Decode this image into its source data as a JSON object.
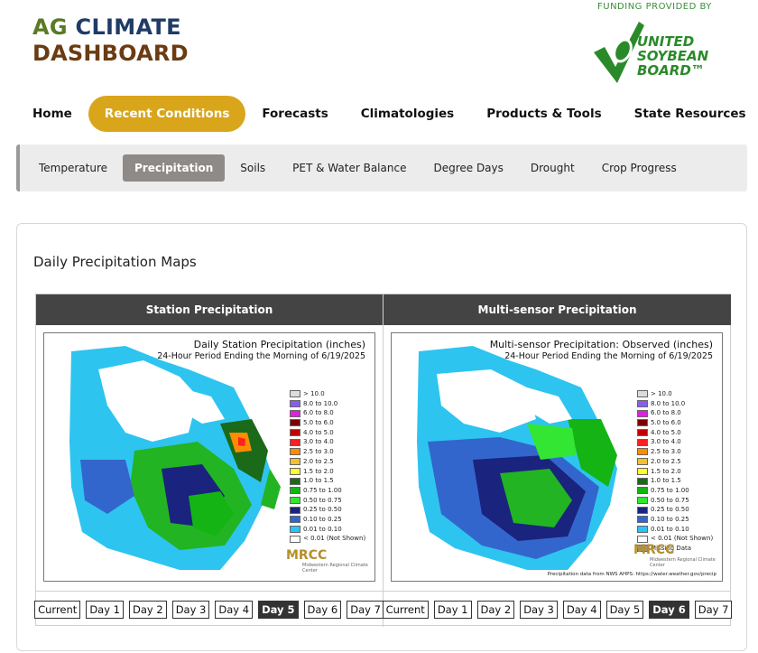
{
  "header": {
    "title_line1_a": "AG",
    "title_line1_b": "CLIMATE",
    "title_line2": "DASHBOARD",
    "funding": "FUNDING PROVIDED BY",
    "sponsor": [
      "UNITED",
      "SOYBEAN",
      "BOARD™"
    ]
  },
  "mainnav": [
    "Home",
    "Recent Conditions",
    "Forecasts",
    "Climatologies",
    "Products & Tools",
    "State Resources"
  ],
  "subnav": [
    "Temperature",
    "Precipitation",
    "Soils",
    "PET & Water Balance",
    "Degree Days",
    "Drought",
    "Crop Progress"
  ],
  "panel_title": "Daily Precipitation Maps",
  "station": {
    "header": "Station Precipitation",
    "map_title": "Daily Station Precipitation (inches)",
    "map_sub": "24-Hour Period Ending the Morning of 6/19/2025",
    "days": [
      "Current",
      "Day 1",
      "Day 2",
      "Day 3",
      "Day 4",
      "Day 5",
      "Day 6",
      "Day 7"
    ],
    "active_day": "Day 5"
  },
  "multisensor": {
    "header": "Multi-sensor Precipitation",
    "map_title": "Multi-sensor Precipitation: Observed (inches)",
    "map_sub": "24-Hour Period Ending the Morning of 6/19/2025",
    "credit": "Precipitation data from NWS AHPS: https://water.weather.gov/precip",
    "days": [
      "Current",
      "Day 1",
      "Day 2",
      "Day 3",
      "Day 4",
      "Day 5",
      "Day 6",
      "Day 7"
    ],
    "active_day": "Day 6"
  },
  "legend_station": [
    {
      "label": "> 10.0",
      "color": "#dcdcdc"
    },
    {
      "label": "8.0 to 10.0",
      "color": "#8a5cf0"
    },
    {
      "label": "6.0 to 8.0",
      "color": "#e020e0"
    },
    {
      "label": "5.0 to 6.0",
      "color": "#7a0000"
    },
    {
      "label": "4.0 to 5.0",
      "color": "#c00000"
    },
    {
      "label": "3.0 to 4.0",
      "color": "#ff2020"
    },
    {
      "label": "2.5 to 3.0",
      "color": "#ff8c00"
    },
    {
      "label": "2.0 to 2.5",
      "color": "#f2c030"
    },
    {
      "label": "1.5 to 2.0",
      "color": "#ffff33"
    },
    {
      "label": "1.0 to 1.5",
      "color": "#1a6a1a"
    },
    {
      "label": "0.75 to 1.00",
      "color": "#14b414"
    },
    {
      "label": "0.50 to 0.75",
      "color": "#33e633"
    },
    {
      "label": "0.25 to 0.50",
      "color": "#1a237e"
    },
    {
      "label": "0.10 to 0.25",
      "color": "#3366cc"
    },
    {
      "label": "0.01 to 0.10",
      "color": "#29c5f6"
    },
    {
      "label": "< 0.01 (Not Shown)",
      "color": "#ffffff"
    }
  ],
  "legend_multi": [
    {
      "label": "> 10.0",
      "color": "#dcdcdc"
    },
    {
      "label": "8.0 to 10.0",
      "color": "#8a5cf0"
    },
    {
      "label": "6.0 to 8.0",
      "color": "#e020e0"
    },
    {
      "label": "5.0 to 6.0",
      "color": "#7a0000"
    },
    {
      "label": "4.0 to 5.0",
      "color": "#c00000"
    },
    {
      "label": "3.0 to 4.0",
      "color": "#ff2020"
    },
    {
      "label": "2.5 to 3.0",
      "color": "#ff8c00"
    },
    {
      "label": "2.0 to 2.5",
      "color": "#f2c030"
    },
    {
      "label": "1.5 to 2.0",
      "color": "#ffff33"
    },
    {
      "label": "1.0 to 1.5",
      "color": "#1a6a1a"
    },
    {
      "label": "0.75 to 1.00",
      "color": "#14b414"
    },
    {
      "label": "0.50 to 0.75",
      "color": "#33e633"
    },
    {
      "label": "0.25 to 0.50",
      "color": "#1a237e"
    },
    {
      "label": "0.10 to 0.25",
      "color": "#3366cc"
    },
    {
      "label": "0.01 to 0.10",
      "color": "#29c5f6"
    },
    {
      "label": "< 0.01 (Not Shown)",
      "color": "#ffffff"
    },
    {
      "label": "Missing Data",
      "color": "#a89080"
    }
  ],
  "mrcc": {
    "name": "MRCC",
    "sub": "Midwestern Regional Climate Center"
  },
  "colors": {
    "accent": "#d9a51b",
    "header_bg": "#444444",
    "subnav_active": "#8e8a88"
  }
}
